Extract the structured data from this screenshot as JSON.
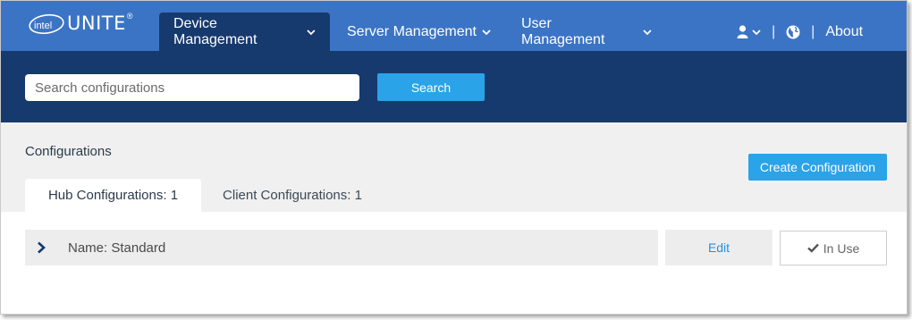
{
  "brand": {
    "logo_text": "intel",
    "product": "UNITE",
    "registered": "®"
  },
  "nav": {
    "items": [
      {
        "label": "Device Management",
        "active": true,
        "icon": "chevron-down-icon"
      },
      {
        "label": "Server Management",
        "active": false,
        "icon": "chevron-down-icon"
      },
      {
        "label": "User Management",
        "active": false,
        "icon": "chevron-down-icon"
      }
    ],
    "user_icon": "user-icon",
    "separator": "|",
    "globe_icon": "globe-icon",
    "about_label": "About"
  },
  "search": {
    "placeholder": "Search configurations",
    "value": "",
    "button_label": "Search"
  },
  "configurations": {
    "title": "Configurations",
    "create_button_label": "Create Configuration",
    "tabs": [
      {
        "label": "Hub Configurations: 1",
        "active": true
      },
      {
        "label": "Client Configurations: 1",
        "active": false
      }
    ],
    "rows": [
      {
        "name": "Name: Standard",
        "edit_label": "Edit",
        "status_label": "In Use",
        "expand_icon": "chevron-right-icon",
        "status_icon": "check-icon"
      }
    ]
  },
  "colors": {
    "nav_bg": "#3b74c4",
    "nav_active_bg": "#163a6e",
    "search_band_bg": "#163a6e",
    "accent_button": "#2aa3e8",
    "edit_link": "#2a8fd8",
    "config_area_bg": "#f0f0f0"
  }
}
